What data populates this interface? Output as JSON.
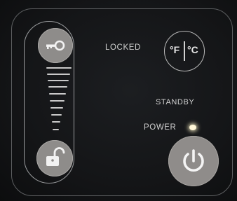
{
  "panel": {
    "locked_label": "LOCKED",
    "standby_label": "STANDBY",
    "power_label": "POWER",
    "unit_button": {
      "fahrenheit": "°F",
      "celsius": "°C"
    },
    "lock_slider": {
      "top_icon": "key-icon",
      "bottom_icon": "unlock-icon",
      "level_bars": 10
    },
    "power_button_icon": "power-icon",
    "power_led_state": "on"
  },
  "colors": {
    "background": "#141517",
    "outline": "#9a9c9e",
    "button_fill": "#8f8c8a",
    "text": "#d0d0d0",
    "led": "#fff7d8"
  }
}
